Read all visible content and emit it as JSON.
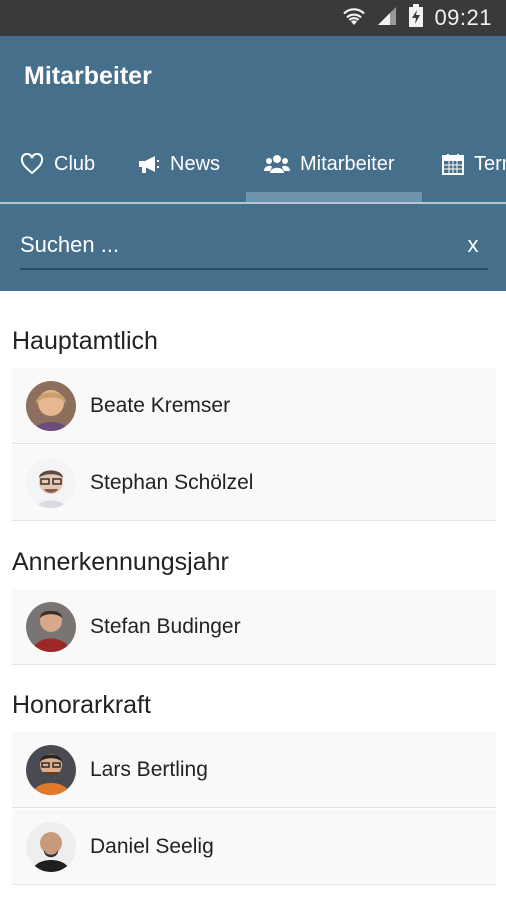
{
  "status_bar": {
    "time": "09:21",
    "icons": [
      "wifi-icon",
      "signal-icon",
      "battery-charging-icon"
    ]
  },
  "app_bar": {
    "title": "Mitarbeiter"
  },
  "tabs": [
    {
      "label": "Club",
      "icon": "heart-icon"
    },
    {
      "label": "News",
      "icon": "megaphone-icon"
    },
    {
      "label": "Mitarbeiter",
      "icon": "users-icon",
      "selected": true
    },
    {
      "label": "Termine",
      "icon": "calendar-icon"
    }
  ],
  "search": {
    "placeholder": "Suchen ...",
    "value": "",
    "clear_label": "x"
  },
  "sections": [
    {
      "title": "Hauptamtlich",
      "members": [
        {
          "name": "Beate Kremser"
        },
        {
          "name": "Stephan Schölzel"
        }
      ]
    },
    {
      "title": "Annerkennungsjahr",
      "members": [
        {
          "name": "Stefan Budinger"
        }
      ]
    },
    {
      "title": "Honorarkraft",
      "members": [
        {
          "name": "Lars Bertling"
        },
        {
          "name": "Daniel Seelig"
        }
      ]
    }
  ],
  "colors": {
    "app_bar": "#466f8c",
    "status_bar": "#3a3a3a",
    "tab_indicator": "#6d93ad"
  }
}
